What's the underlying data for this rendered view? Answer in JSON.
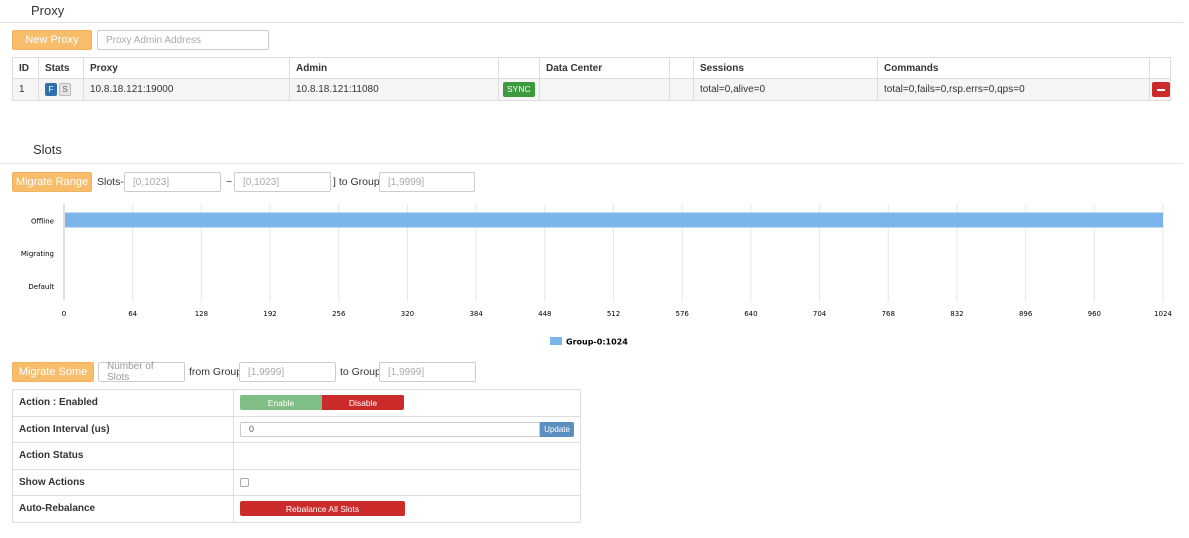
{
  "proxy": {
    "title": "Proxy",
    "new_proxy_label": "New Proxy",
    "admin_placeholder": "Proxy Admin Address",
    "table": {
      "headers": [
        "ID",
        "Stats",
        "Proxy",
        "Admin",
        "",
        "Data Center",
        "",
        "Sessions",
        "Commands",
        ""
      ],
      "rows": [
        {
          "id": "1",
          "stat_f": "F",
          "stat_s": "S",
          "proxy": "10.8.18.121:19000",
          "admin": "10.8.18.121:11080",
          "sync": "SYNC",
          "data_center": "",
          "sessions": "total=0,alive=0",
          "commands": "total=0,fails=0,rsp.errs=0,qps=0"
        }
      ]
    }
  },
  "slots": {
    "title": "Slots",
    "migrate_range_label": "Migrate Range",
    "slots_prefix": "Slots-[",
    "range_start_placeholder": "[0,1023]",
    "tilde": "~",
    "range_end_placeholder": "[0,1023]",
    "to_group_label": "] to Group",
    "group_placeholder": "[1,9999]"
  },
  "chart_data": {
    "type": "bar",
    "orientation": "horizontal",
    "categories": [
      "Offline",
      "Migrating",
      "Default"
    ],
    "series": [
      {
        "name": "Group-0:1024",
        "color": "#7cb5ec",
        "values": [
          1024,
          0,
          0
        ]
      }
    ],
    "x_ticks": [
      "0",
      "64",
      "128",
      "192",
      "256",
      "320",
      "384",
      "448",
      "512",
      "576",
      "640",
      "704",
      "768",
      "832",
      "896",
      "960",
      "1024"
    ],
    "xlim": [
      0,
      1024
    ],
    "grid": true,
    "legend_position": "bottom-center"
  },
  "migrate_some": {
    "button_label": "Migrate Some",
    "num_slots_placeholder": "Number of Slots",
    "from_group_label": "from Group",
    "from_group_placeholder": "[1,9999]",
    "to_group_label": "to Group",
    "to_group_placeholder": "[1,9999]"
  },
  "actions": {
    "enabled_label": "Action : Enabled",
    "enable_button": "Enable",
    "disable_button": "Disable",
    "interval_label": "Action Interval (us)",
    "interval_value": "0",
    "update_button": "Update",
    "status_label": "Action Status",
    "status_value": "",
    "show_actions_label": "Show Actions",
    "show_actions_checked": false,
    "auto_rebalance_label": "Auto-Rebalance",
    "rebalance_button": "Rebalance All Slots"
  },
  "colors": {
    "accent_orange": "#f7bd6b",
    "danger_red": "#cc2b2b",
    "success_green": "#3e9a3e",
    "primary_blue": "#2f6fae",
    "bar_blue": "#7cb5ec"
  }
}
